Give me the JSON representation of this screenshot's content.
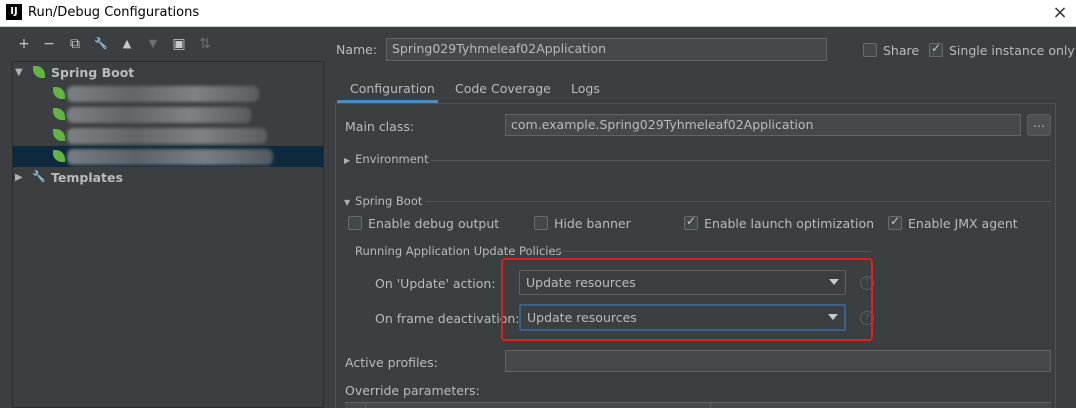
{
  "window": {
    "title": "Run/Debug Configurations",
    "app_logo": "IJ",
    "close": "×"
  },
  "toolbar": {
    "add": "+",
    "remove": "−",
    "copy": "⧉",
    "edit": "🔧",
    "up": "▲",
    "down": "▼",
    "folder": "▣",
    "sort": "⇅"
  },
  "tree": {
    "spring_boot": "Spring Boot",
    "templates": "Templates",
    "expanded_arrow": "▼",
    "collapsed_arrow": "▶"
  },
  "name": {
    "label": "Name:",
    "value": "Spring029Tyhmeleaf02Application"
  },
  "share": {
    "label": "Share",
    "checked": false
  },
  "single_instance": {
    "label": "Single instance only",
    "checked": true
  },
  "tabs": [
    {
      "label": "Configuration",
      "active": true
    },
    {
      "label": "Code Coverage",
      "active": false
    },
    {
      "label": "Logs",
      "active": false
    }
  ],
  "main_class": {
    "label": "Main class:",
    "value": "com.example.Spring029Tyhmeleaf02Application",
    "browse": "..."
  },
  "environment": {
    "label": "Environment"
  },
  "spring_boot_section": {
    "label": "Spring Boot",
    "enable_debug_output": {
      "label": "Enable debug output",
      "checked": false
    },
    "hide_banner": {
      "label": "Hide banner",
      "checked": false
    },
    "enable_launch_optimization": {
      "label": "Enable launch optimization",
      "checked": true
    },
    "enable_jmx_agent": {
      "label": "Enable JMX agent",
      "checked": true
    }
  },
  "update_policies": {
    "title": "Running Application Update Policies",
    "on_update": {
      "label": "On 'Update' action:",
      "value": "Update resources"
    },
    "on_frame": {
      "label": "On frame deactivation:",
      "value": "Update resources"
    },
    "help": "?"
  },
  "active_profiles": {
    "label": "Active profiles:",
    "value": ""
  },
  "override_parameters": {
    "label": "Override parameters:"
  },
  "colors": {
    "accent": "#4a88c7",
    "highlight_box": "#e0201b",
    "spring_green": "#62b543"
  }
}
